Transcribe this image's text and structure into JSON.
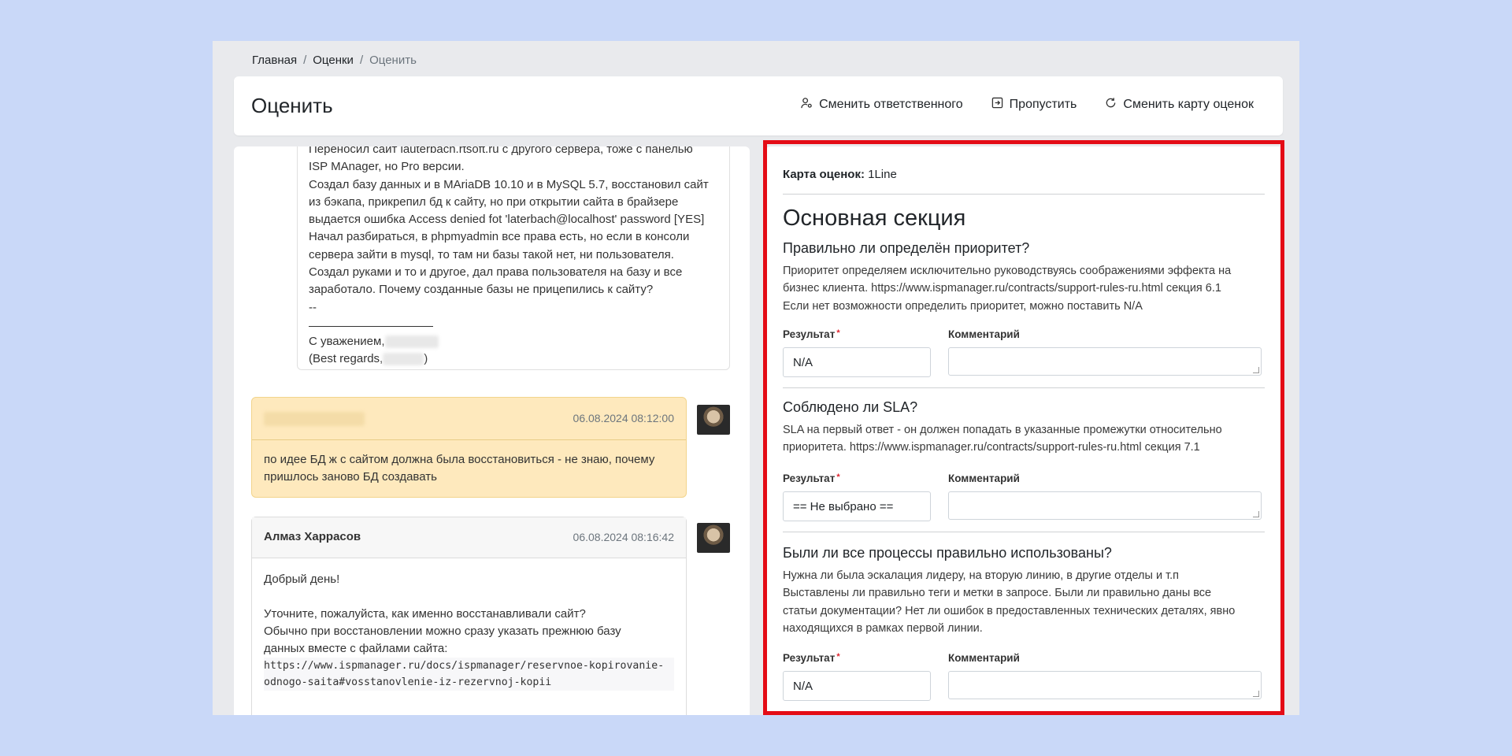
{
  "breadcrumb": {
    "home": "Главная",
    "ratings": "Оценки",
    "current": "Оценить",
    "sep": "/"
  },
  "header": {
    "title": "Оценить",
    "actions": {
      "change_owner": "Сменить ответственного",
      "skip": "Пропустить",
      "change_card": "Сменить карту оценок"
    }
  },
  "ticket": {
    "email_lines": [
      "Переносил сайт lauterbach.rtsoft.ru с другого сервера, тоже с панелью",
      "ISP MAnager, но Pro версии.",
      "Создал базу данных и в MAriaDB 10.10 и в MySQL 5.7, восстановил сайт",
      "из бэкапа, прикрепил бд к сайту, но при открытии сайта в брайзере",
      "выдается ошибка Access denied fot 'laterbach@localhost' password [YES]",
      "Начал разбираться, в phpmyadmin все права есть, но если в консоли",
      "сервера зайти в mysql, то там ни базы такой нет, ни пользователя.",
      "Создал руками и то и другое, дал права пользователя на базу и все",
      "заработало. Почему созданные базы не прицепились к сайту?",
      "--"
    ],
    "signature_ru": "С уважением,",
    "signature_en": "(Best regards,",
    "signature_close": ")",
    "note_date": "06.08.2024 08:12:00",
    "note_text": "по идее БД ж с сайтом должна была восстановиться - не знаю, почему пришлось заново БД создавать",
    "reply_author": "Алмаз Харрасов",
    "reply_date": "06.08.2024 08:16:42",
    "reply_greeting": "Добрый день!",
    "reply_line1": "Уточните, пожалуйста, как именно восстанавливали сайт?",
    "reply_line2": "Обычно при восстановлении можно сразу указать прежнюю базу",
    "reply_line3": "данных вместе с файлами сайта:",
    "reply_code1": "https://www.ispmanager.ru/docs/ispmanager/reservnoe-kopirovanie-",
    "reply_code2": "odnogo-saita#vosstanovlenie-iz-rezervnoj-kopii"
  },
  "rating_card": {
    "label": "Карта оценок:",
    "value": "1Line",
    "section_title": "Основная секция",
    "result_label": "Результат",
    "required_mark": "*",
    "comment_label": "Комментарий",
    "questions": [
      {
        "title": "Правильно ли определён приоритет?",
        "desc_lines": [
          "Приоритет определяем исключительно руководствуясь соображениями эффекта на",
          "бизнес клиента. https://www.ispmanager.ru/contracts/support-rules-ru.html секция 6.1",
          "Если нет возможности определить приоритет, можно поставить N/A"
        ],
        "result": "N/A"
      },
      {
        "title": "Соблюдено ли SLA?",
        "desc_lines": [
          "SLA на первый ответ - он должен попадать в указанные промежутки относительно",
          "приоритета. https://www.ispmanager.ru/contracts/support-rules-ru.html секция 7.1"
        ],
        "result": "== Не выбрано =="
      },
      {
        "title": "Были ли все процессы правильно использованы?",
        "desc_lines": [
          "Нужна ли была эскалация лидеру, на вторую линию, в другие отделы и т.п",
          "Выставлены ли правильно теги и метки в запросе. Были ли правильно даны все",
          "статьи документации? Нет ли ошибок в предоставленных технических деталях, явно",
          "находящихся в рамках первой линии."
        ],
        "result": "N/A"
      }
    ]
  },
  "colors": {
    "highlight": "#e40c16",
    "note_bg": "#fee9bd",
    "page_bg": "#c9d8f8"
  }
}
